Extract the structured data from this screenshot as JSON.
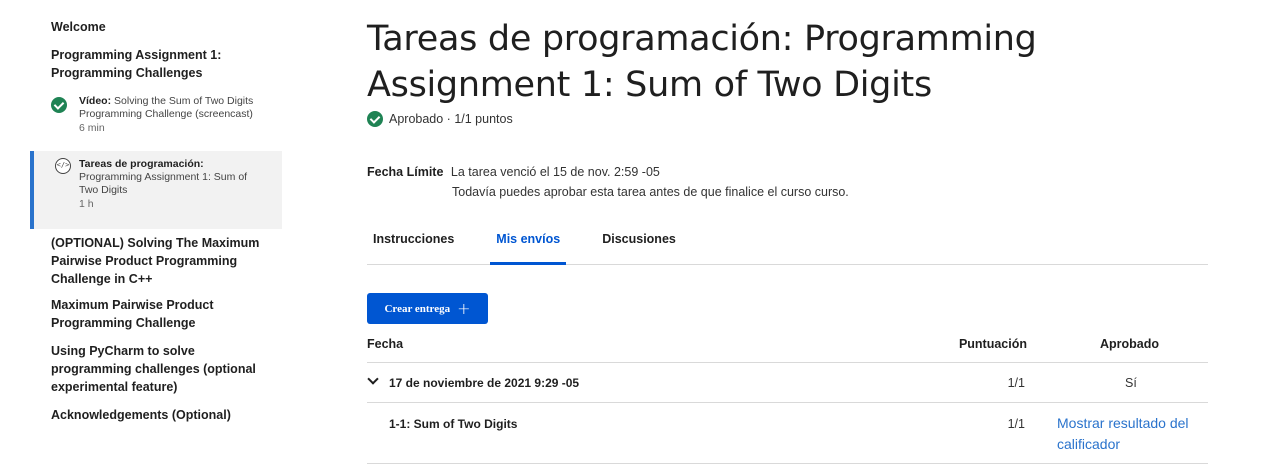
{
  "sidebar": {
    "welcome": "Welcome",
    "week_title": "Programming Assignment 1: Programming Challenges",
    "items": [
      {
        "type_label": "Vídeo:",
        "label": "Solving the Sum of Two Digits Programming Challenge (screencast)",
        "duration": "6 min",
        "icon": "check-circle-icon",
        "completed": true
      },
      {
        "type_label": "Tareas de programación:",
        "label": "Programming Assignment 1: Sum of Two Digits",
        "duration": "1 h",
        "icon": "code-icon",
        "active": true
      }
    ],
    "sections": [
      "(OPTIONAL) Solving The Maximum Pairwise Product Programming Challenge in C++",
      "Maximum Pairwise Product Programming Challenge",
      "Using PyCharm to solve programming challenges (optional experimental feature)",
      "Acknowledgements (Optional)"
    ]
  },
  "main": {
    "title": "Tareas de programación: Programming Assignment 1: Sum of Two Digits",
    "status": "Aprobado · 1/1 puntos",
    "deadline": {
      "label": "Fecha Límite",
      "line1": "La tarea venció el 15 de nov. 2:59 -05",
      "line2": "Todavía puedes aprobar esta tarea antes de que finalice el curso curso."
    },
    "tabs": [
      {
        "label": "Instrucciones",
        "active": false
      },
      {
        "label": "Mis envíos",
        "active": true
      },
      {
        "label": "Discusiones",
        "active": false
      }
    ],
    "create_button": "Crear entrega",
    "table": {
      "headers": {
        "fecha": "Fecha",
        "puntuacion": "Puntuación",
        "aprobado": "Aprobado"
      },
      "submission": {
        "date": "17 de noviembre de 2021 9:29 -05",
        "score": "1/1",
        "passed": "Sí"
      },
      "part": {
        "name": "1-1: Sum of Two Digits",
        "score": "1/1",
        "link": "Mostrar resultado del calificador"
      }
    }
  },
  "colors": {
    "accent": "#0056d2",
    "link": "#2a73cc",
    "success": "#1f8354"
  }
}
